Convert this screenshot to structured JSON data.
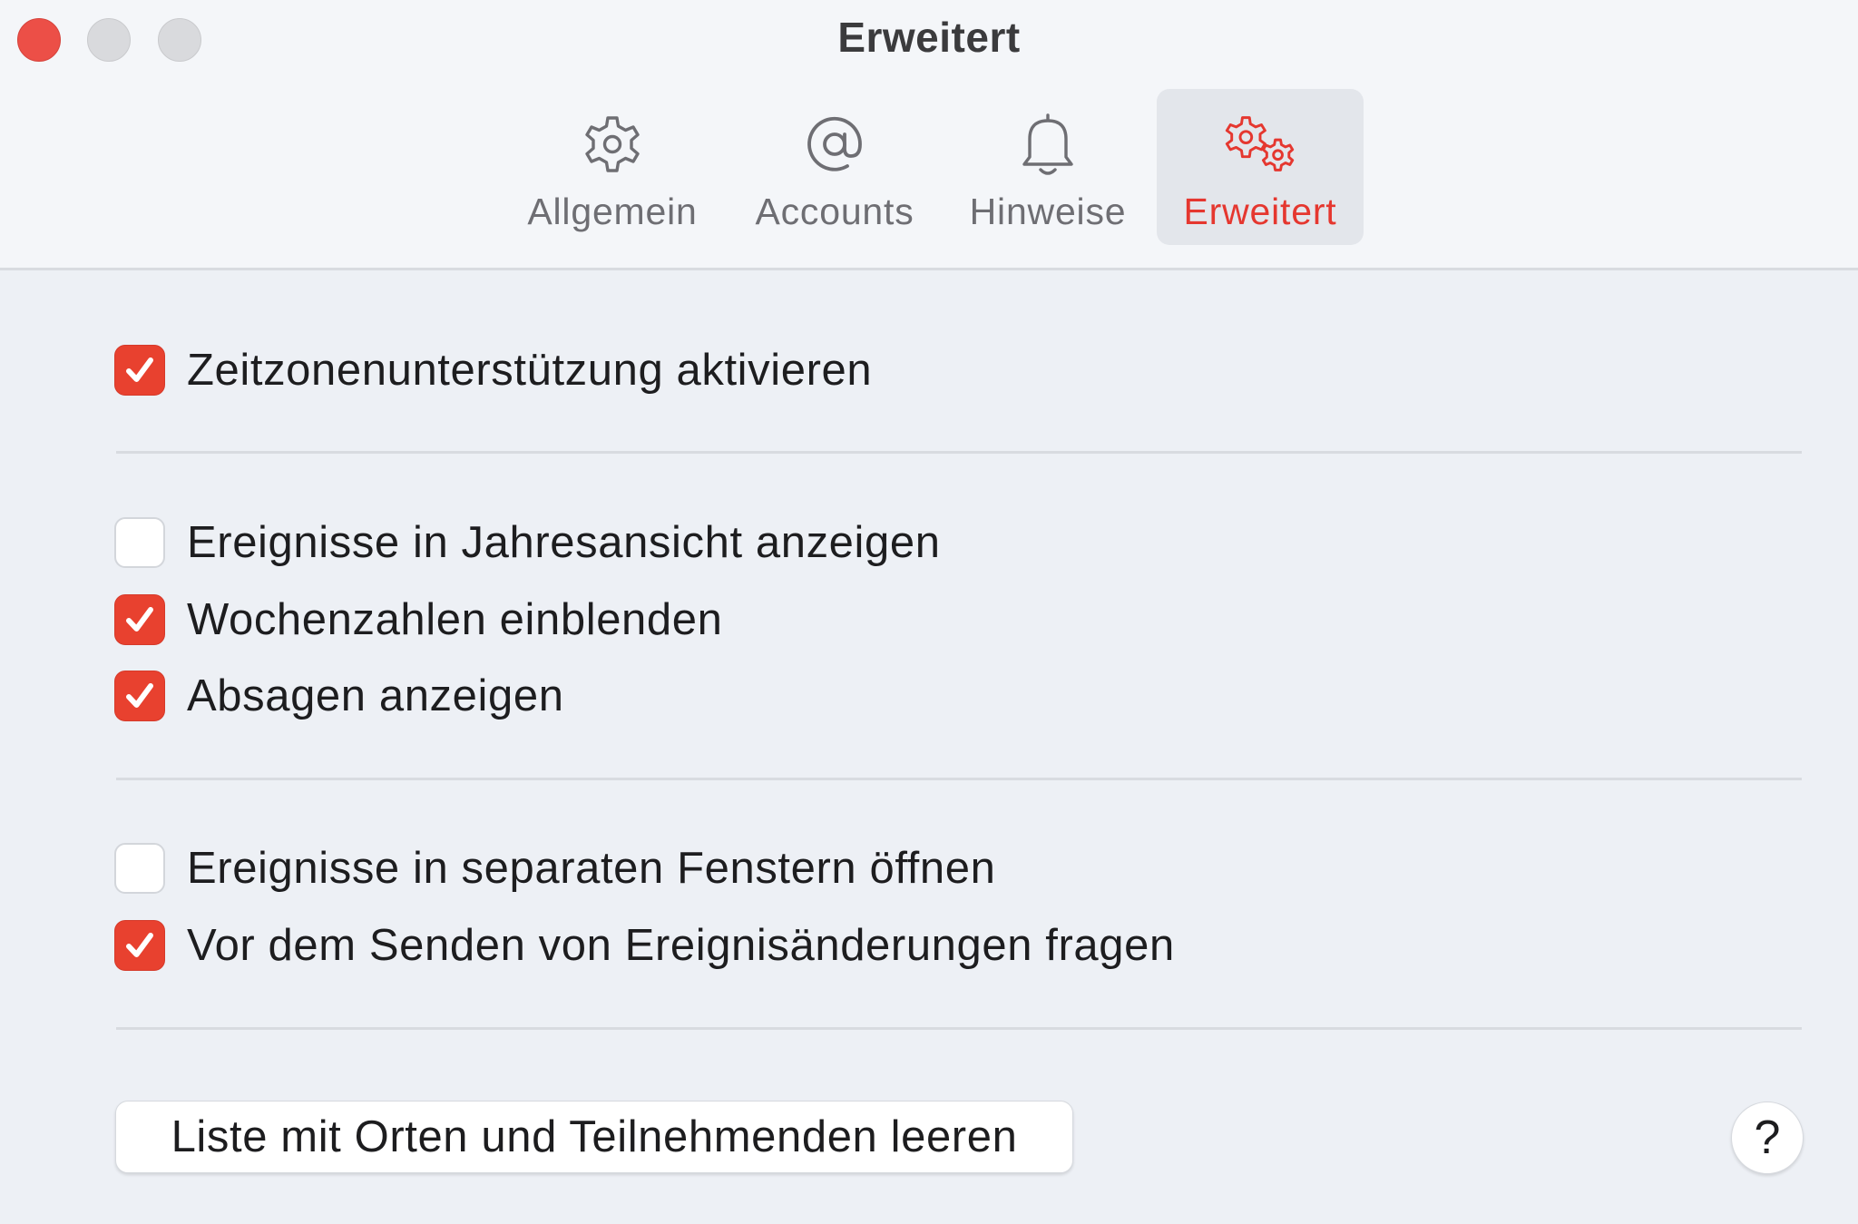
{
  "window": {
    "title": "Erweitert",
    "controls": [
      "close",
      "minimize",
      "zoom"
    ]
  },
  "toolbar": {
    "tabs": [
      {
        "label": "Allgemein",
        "icon": "gear-icon",
        "active": false
      },
      {
        "label": "Accounts",
        "icon": "at-sign-icon",
        "active": false
      },
      {
        "label": "Hinweise",
        "icon": "bell-icon",
        "active": false
      },
      {
        "label": "Erweitert",
        "icon": "double-gear-icon",
        "active": true
      }
    ]
  },
  "options": [
    {
      "label": "Zeitzonenunterstützung aktivieren",
      "checked": true
    },
    {
      "label": "Ereignisse in Jahresansicht anzeigen",
      "checked": false
    },
    {
      "label": "Wochenzahlen einblenden",
      "checked": true
    },
    {
      "label": "Absagen anzeigen",
      "checked": true
    },
    {
      "label": "Ereignisse in separaten Fenstern öffnen",
      "checked": false
    },
    {
      "label": "Vor dem Senden von Ereignisänderungen fragen",
      "checked": true
    }
  ],
  "footer": {
    "clear_button_label": "Liste mit Orten und Teilnehmenden leeren",
    "help_button_label": "?"
  },
  "colors": {
    "accent": "#e8412f",
    "active_tab_label": "#e5372f",
    "close_button": "#ec4f47",
    "background": "#edf0f5"
  }
}
